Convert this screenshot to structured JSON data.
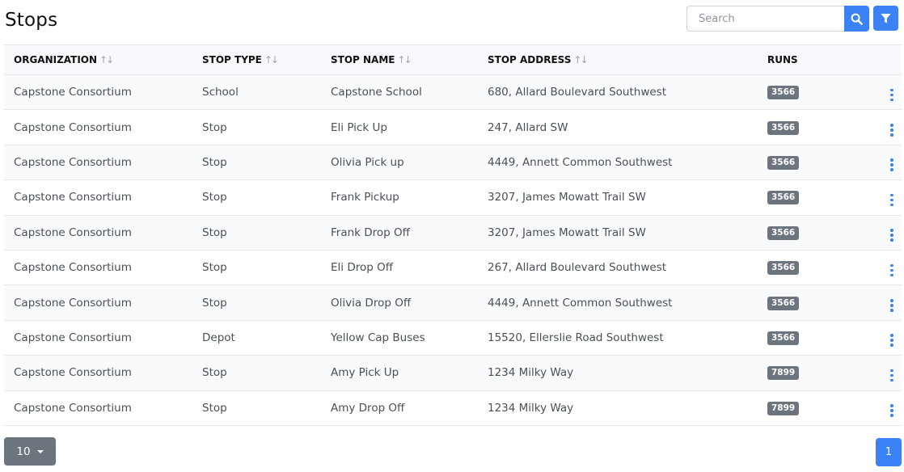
{
  "page": {
    "title": "Stops"
  },
  "search": {
    "placeholder": "Search"
  },
  "icons": {
    "search": "search-icon",
    "filter": "filter-icon",
    "sort": "sort-icon",
    "row_actions": "kebab-menu-icon",
    "dropdown": "caret-down-icon"
  },
  "colors": {
    "primary": "#3b82f6",
    "badge": "#6c757d",
    "stripe": "#f9fafc"
  },
  "table": {
    "headers": {
      "organization": "ORGANIZATION",
      "stop_type": "STOP TYPE",
      "stop_name": "STOP NAME",
      "stop_address": "STOP ADDRESS",
      "runs": "RUNS"
    },
    "sort_glyph": "↑↓",
    "rows": [
      {
        "organization": "Capstone Consortium",
        "stop_type": "School",
        "stop_name": "Capstone School",
        "stop_address": "680, Allard Boulevard Southwest",
        "runs": "3566"
      },
      {
        "organization": "Capstone Consortium",
        "stop_type": "Stop",
        "stop_name": "Eli Pick Up",
        "stop_address": "247, Allard SW",
        "runs": "3566"
      },
      {
        "organization": "Capstone Consortium",
        "stop_type": "Stop",
        "stop_name": "Olivia Pick up",
        "stop_address": "4449, Annett Common Southwest",
        "runs": "3566"
      },
      {
        "organization": "Capstone Consortium",
        "stop_type": "Stop",
        "stop_name": "Frank Pickup",
        "stop_address": "3207, James Mowatt Trail SW",
        "runs": "3566"
      },
      {
        "organization": "Capstone Consortium",
        "stop_type": "Stop",
        "stop_name": "Frank Drop Off",
        "stop_address": "3207, James Mowatt Trail SW",
        "runs": "3566"
      },
      {
        "organization": "Capstone Consortium",
        "stop_type": "Stop",
        "stop_name": "Eli Drop Off",
        "stop_address": "267, Allard Boulevard Southwest",
        "runs": "3566"
      },
      {
        "organization": "Capstone Consortium",
        "stop_type": "Stop",
        "stop_name": "Olivia Drop Off",
        "stop_address": "4449, Annett Common Southwest",
        "runs": "3566"
      },
      {
        "organization": "Capstone Consortium",
        "stop_type": "Depot",
        "stop_name": "Yellow Cap Buses",
        "stop_address": "15520, Ellerslie Road Southwest",
        "runs": "3566"
      },
      {
        "organization": "Capstone Consortium",
        "stop_type": "Stop",
        "stop_name": "Amy Pick Up",
        "stop_address": "1234 Milky Way",
        "runs": "7899"
      },
      {
        "organization": "Capstone Consortium",
        "stop_type": "Stop",
        "stop_name": "Amy Drop Off",
        "stop_address": "1234 Milky Way",
        "runs": "7899"
      }
    ]
  },
  "pagination": {
    "page_size": "10",
    "current_page": "1"
  }
}
